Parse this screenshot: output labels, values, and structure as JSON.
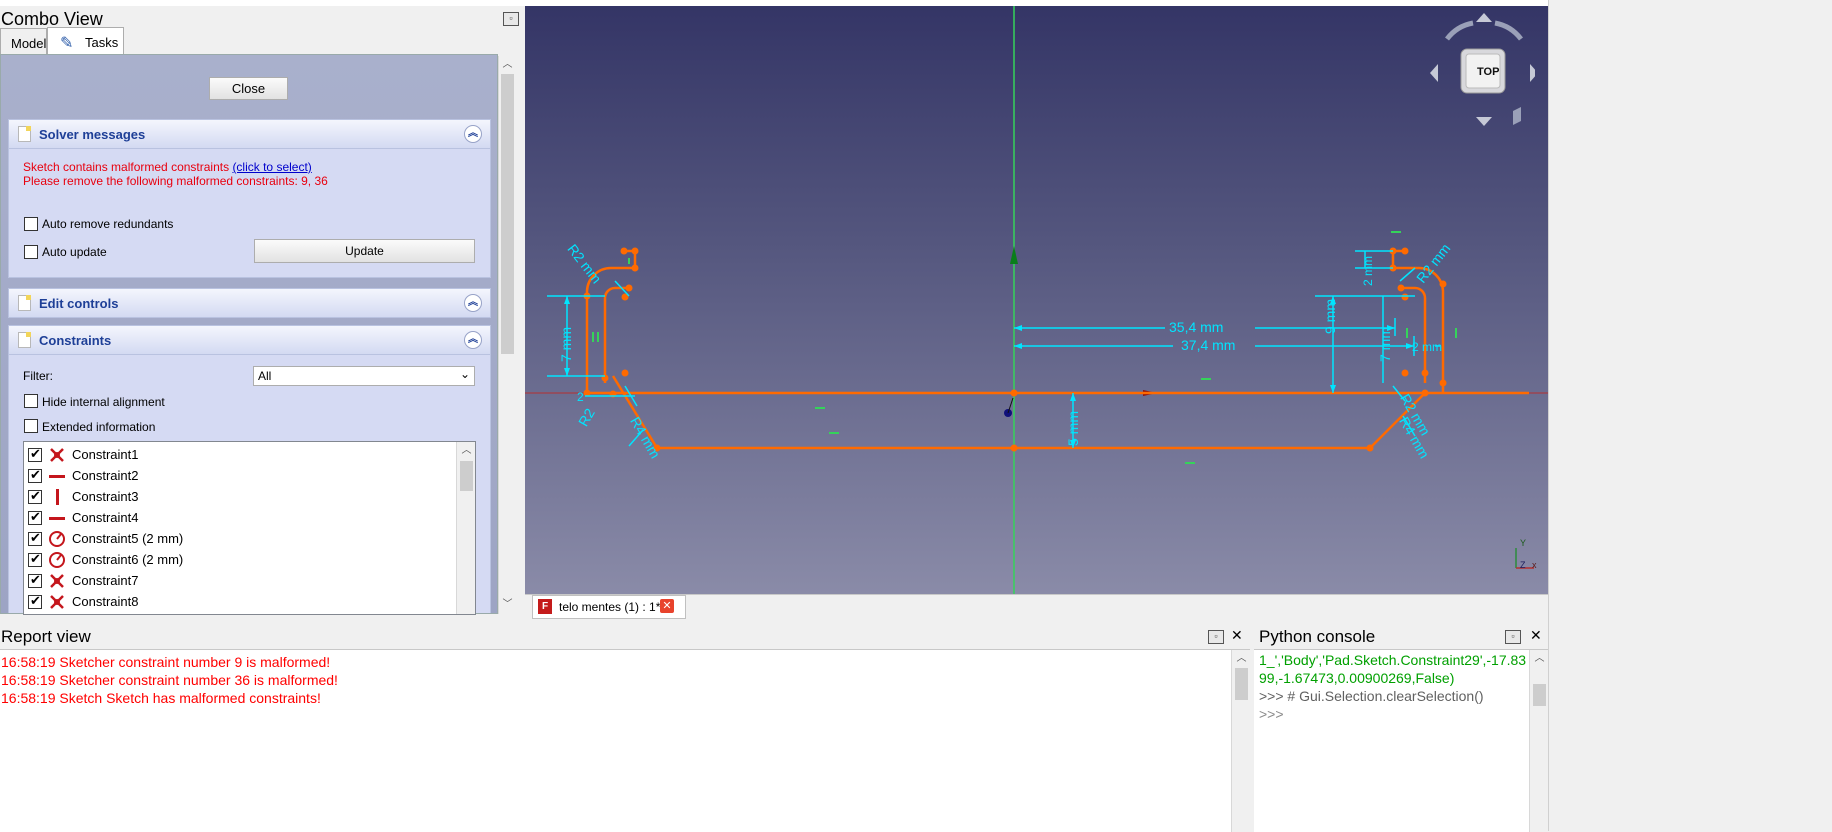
{
  "combo_view": {
    "title": "Combo View",
    "tabs": [
      {
        "label": "Model",
        "active": false
      },
      {
        "label": "Tasks",
        "active": true
      }
    ],
    "close_label": "Close"
  },
  "solver_panel": {
    "title": "Solver messages",
    "message_line1": "Sketch contains malformed constraints ",
    "message_link": "(click to select)",
    "message_line2": "Please remove the following malformed constraints: 9, 36",
    "auto_remove_label": "Auto remove redundants",
    "auto_update_label": "Auto update",
    "update_label": "Update"
  },
  "edit_controls": {
    "title": "Edit controls"
  },
  "constraints_panel": {
    "title": "Constraints",
    "filter_label": "Filter:",
    "filter_value": "All",
    "hide_internal_label": "Hide internal alignment",
    "extended_info_label": "Extended information",
    "items": [
      {
        "label": "Constraint1",
        "icon": "coincident-icon"
      },
      {
        "label": "Constraint2",
        "icon": "horizontal-icon"
      },
      {
        "label": "Constraint3",
        "icon": "vertical-icon"
      },
      {
        "label": "Constraint4",
        "icon": "horizontal-icon"
      },
      {
        "label": "Constraint5 (2 mm)",
        "icon": "radius-icon"
      },
      {
        "label": "Constraint6 (2 mm)",
        "icon": "radius-icon"
      },
      {
        "label": "Constraint7",
        "icon": "coincident-icon"
      },
      {
        "label": "Constraint8",
        "icon": "coincident-icon"
      }
    ]
  },
  "viewport": {
    "dimensions": {
      "d1": "35,4 mm",
      "d2": "37,4 mm",
      "d3": "9 mm",
      "d4": "7 mm",
      "d5": "7 mm",
      "d6": "5 mm",
      "r1": "R2 mm",
      "r2": "R4 mm",
      "r3": "R2 mm",
      "r4": "R4 mm",
      "r5": "R2",
      "r6": "R2 mm",
      "s1": "2 mm",
      "s2": "2",
      "s3": "2 mm"
    },
    "navcube_label": "TOP",
    "axis_x": "x",
    "axis_y": "Y",
    "axis_z": "Z"
  },
  "document_tab": {
    "label": "telo mentes (1) : 1*"
  },
  "report_view": {
    "title": "Report view",
    "lines": [
      "16:58:19  Sketcher constraint number 9 is malformed!",
      "16:58:19  Sketcher constraint number 36 is malformed!",
      "16:58:19  Sketch Sketch has malformed constraints!"
    ]
  },
  "python_console": {
    "title": "Python console",
    "lines": [
      "1_','Body','Pad.Sketch.Constraint29',-17.83",
      "99,-1.67473,0.00900269,False)",
      ">>> # Gui.Selection.clearSelection()",
      ">>>"
    ]
  },
  "colors": {
    "geometry": "#ff6a00",
    "constraint": "#00e5ff",
    "error_text": "#ff0000",
    "axis_green": "#35d35a",
    "axis_red": "#b43030"
  }
}
